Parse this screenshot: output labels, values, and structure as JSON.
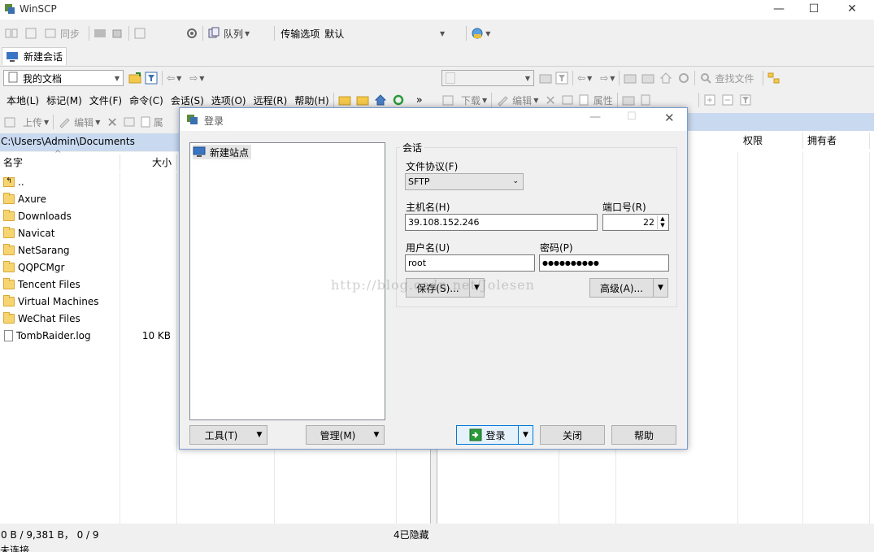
{
  "window": {
    "title": "WinSCP",
    "controls": [
      "—",
      "☐",
      "✕"
    ]
  },
  "toolbar1": {
    "sync_label": "同步",
    "queue_label": "队列",
    "transfer_label": "传输选项",
    "transfer_value": "默认"
  },
  "session_tab": {
    "label": "新建会话"
  },
  "local": {
    "path_combo": "我的文档",
    "menu": [
      "本地(L)",
      "标记(M)",
      "文件(F)",
      "命令(C)",
      "会话(S)",
      "选项(O)",
      "远程(R)",
      "帮助(H)"
    ],
    "upload_label": "上传",
    "edit_label": "编辑",
    "props_label": "属",
    "path": "C:\\Users\\Admin\\Documents",
    "col_name": "名字",
    "col_size": "大小",
    "files": [
      {
        "name": "..",
        "size": "",
        "type": "up"
      },
      {
        "name": "Axure",
        "size": "",
        "type": "folder"
      },
      {
        "name": "Downloads",
        "size": "",
        "type": "folder"
      },
      {
        "name": "Navicat",
        "size": "",
        "type": "folder"
      },
      {
        "name": "NetSarang",
        "size": "",
        "type": "folder"
      },
      {
        "name": "QQPCMgr",
        "size": "",
        "type": "folder"
      },
      {
        "name": "Tencent Files",
        "size": "",
        "type": "folder"
      },
      {
        "name": "Virtual Machines",
        "size": "",
        "type": "folder"
      },
      {
        "name": "WeChat Files",
        "size": "",
        "type": "folder"
      },
      {
        "name": "TombRaider.log",
        "size": "10 KB",
        "type": "file"
      }
    ],
    "status": "0 B / 9,381 B，  0 / 9",
    "hidden": "4已隐藏"
  },
  "remote": {
    "find_label": "查找文件",
    "download_label": "下载",
    "edit_label": "编辑",
    "props_label": "属性",
    "col_perm": "权限",
    "col_owner": "拥有者"
  },
  "bottom_status": "未连接",
  "dialog": {
    "title": "登录",
    "site_item": "新建站点",
    "group_label": "会话",
    "protocol_label": "文件协议(F)",
    "protocol_value": "SFTP",
    "host_label": "主机名(H)",
    "host_value": "39.108.152.246",
    "port_label": "端口号(R)",
    "port_value": "22",
    "user_label": "用户名(U)",
    "user_value": "root",
    "password_label": "密码(P)",
    "password_value": "●●●●●●●●●●",
    "save_btn": "保存(S)...",
    "advanced_btn": "高级(A)...",
    "tools_btn": "工具(T)",
    "manage_btn": "管理(M)",
    "login_btn": "登录",
    "close_btn": "关闭",
    "help_btn": "帮助"
  },
  "watermark": "http://blog.csdn.net/Jolesen"
}
